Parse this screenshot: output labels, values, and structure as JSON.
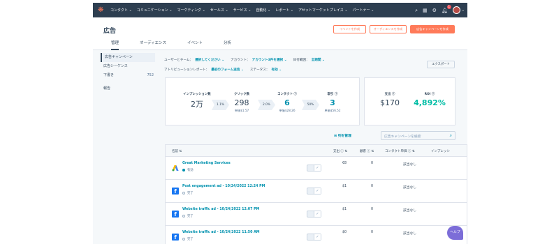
{
  "nav": {
    "logo_glyph": "❋",
    "items": [
      "コンタクト ⌄",
      "コミュニケーション ⌄",
      "マーケティング ⌄",
      "セールス ⌄",
      "サービス ⌄",
      "自動化 ⌄",
      "レポート ⌄",
      "アセットマーケットプレイス ⌄",
      "パートナー ⌄"
    ],
    "notification_count": "1",
    "icons": [
      "search-icon",
      "marketplace-icon",
      "settings-icon",
      "notification-icon"
    ]
  },
  "header": {
    "title": "広告",
    "buttons": [
      "イベントを作成",
      "オーディエンスを作成",
      "広告キャンペーンを作成"
    ],
    "tabs": [
      "管理",
      "オーディエンス",
      "イベント",
      "分析"
    ]
  },
  "sidebar": {
    "items": [
      {
        "label": "広告キャンペーン",
        "count": ""
      },
      {
        "label": "広告シーケンス",
        "count": ""
      },
      {
        "label": "下書き",
        "count": "752"
      }
    ],
    "report_label": "報告"
  },
  "filters": {
    "user_team_label": "ユーザーとチーム：",
    "user_team_value": "選択してください ⌄",
    "account_label": "アカウント：",
    "account_value": "アカウント3件を選択 ⌄",
    "date_label": "日付範囲：",
    "date_value": "全期間 ⌄",
    "attribution_label": "アトリビューションレポート：",
    "attribution_value": "最初のフォーム送信 ⌄",
    "status_label": "ステータス：",
    "status_value": "有効 ⌄",
    "export_label": "エクスポート"
  },
  "stats": {
    "impressions": {
      "label": "インプレッション数",
      "value": "2万"
    },
    "clicks": {
      "label": "クリック数",
      "value": "298",
      "sub": "単価$1.57"
    },
    "contacts": {
      "label": "コンタクト ⓘ",
      "value": "6",
      "sub": "単価$28.26"
    },
    "deals": {
      "label": "取引 ⓘ",
      "value": "3",
      "sub": "単価$56.52"
    },
    "arrows": [
      "1.1%",
      "2.0%",
      "50%"
    ],
    "spend": {
      "label": "支出 ⓘ",
      "value": "$170"
    },
    "roi": {
      "label": "ROI ⓘ",
      "value": "4,892%"
    }
  },
  "toolbar": {
    "manage_columns": "⊞ 列を管理",
    "search_placeholder": "広告キャンペーンを検索"
  },
  "table": {
    "headers": [
      "名前 ⇅",
      "支出 ⓘ ⇅",
      "顧客 ⓘ ⇅",
      "コンタクト単価 ⓘ ⇅",
      "インプレッシ"
    ],
    "rows": [
      {
        "name": "Great Marketing Services",
        "status": "有効",
        "active": true,
        "platform": "google",
        "spend": "€8",
        "customers": "0",
        "cpc": "該当なし"
      },
      {
        "name": "Post engagement ad - 10/24/2022 12:24 PM",
        "status": "完了",
        "active": false,
        "platform": "facebook",
        "spend": "$1",
        "customers": "0",
        "cpc": "該当なし"
      },
      {
        "name": "Website traffic ad - 10/24/2022 12:07 PM",
        "status": "完了",
        "active": false,
        "platform": "facebook",
        "spend": "$1",
        "customers": "0",
        "cpc": "該当なし"
      },
      {
        "name": "Website traffic ad - 10/24/2022 11:50 AM",
        "status": "完了",
        "active": false,
        "platform": "facebook",
        "spend": "$0",
        "customers": "0",
        "cpc": "該当なし"
      }
    ]
  },
  "help_label": "ヘルプ",
  "colors": {
    "nav_bg": "#2d3e50",
    "accent": "#ff7a59",
    "link": "#0091ae",
    "roi": "#00bda5",
    "facebook": "#1877f2"
  }
}
